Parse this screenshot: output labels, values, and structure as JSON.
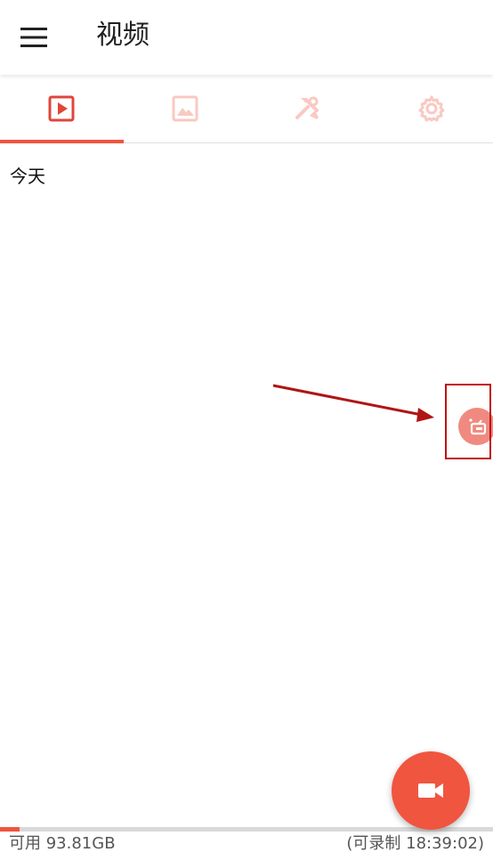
{
  "appbar": {
    "title": "视频",
    "menu_icon": "hamburger-menu-icon"
  },
  "tabs": [
    {
      "id": "videos",
      "icon": "play-video-icon",
      "active": true
    },
    {
      "id": "images",
      "icon": "image-icon",
      "active": false
    },
    {
      "id": "tools",
      "icon": "tools-icon",
      "active": false
    },
    {
      "id": "settings",
      "icon": "gear-icon",
      "active": false
    }
  ],
  "content": {
    "section_header": "今天"
  },
  "floating_button": {
    "icon": "floating-recorder-icon"
  },
  "fab": {
    "icon": "video-camera-icon"
  },
  "storage": {
    "used_fraction": 0.04,
    "available_label": "可用 93.81GB",
    "record_time_label": "(可录制 18:39:02)"
  },
  "colors": {
    "accent": "#f0553f",
    "inactive_tab": "#f9c9c2",
    "floating": "#f08a80",
    "annotation": "#c01010"
  }
}
